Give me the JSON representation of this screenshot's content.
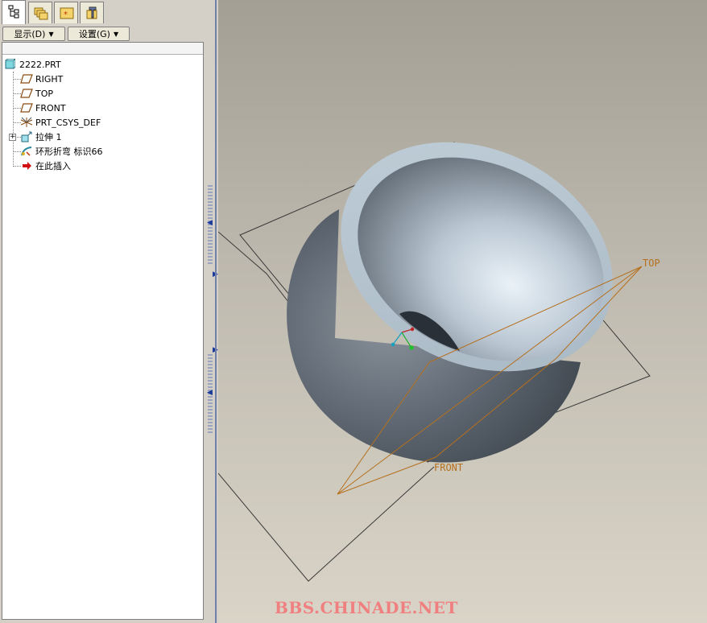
{
  "tabs": [
    {
      "name": "model-tree",
      "icon": "model-tree-icon",
      "active": true
    },
    {
      "name": "folder-browser",
      "icon": "folders-icon",
      "active": false
    },
    {
      "name": "favorites",
      "icon": "favorites-icon",
      "active": false
    },
    {
      "name": "connections",
      "icon": "tools-icon",
      "active": false
    }
  ],
  "toolbar": {
    "display_label": "显示(D)",
    "settings_label": "设置(G)"
  },
  "tree": {
    "root": "2222.PRT",
    "items": [
      {
        "label": "RIGHT",
        "icon": "datum-plane-icon"
      },
      {
        "label": "TOP",
        "icon": "datum-plane-icon"
      },
      {
        "label": "FRONT",
        "icon": "datum-plane-icon"
      },
      {
        "label": "PRT_CSYS_DEF",
        "icon": "coordinate-system-icon"
      },
      {
        "label": "拉伸 1",
        "icon": "extrude-icon"
      },
      {
        "label": "环形折弯 标识66",
        "icon": "toroidal-bend-icon"
      },
      {
        "label": "在此插入",
        "icon": "insert-here-arrow-icon"
      }
    ]
  },
  "viewport": {
    "plane_labels": {
      "top": "TOP",
      "front": "FRONT"
    },
    "watermark": "BBS.CHINADE.NET",
    "colors": {
      "bg_top": "#a39f94",
      "bg_bottom": "#d9d4c7",
      "part_dark": "#4a525c",
      "part_light": "#c8d4e0",
      "plane_top": "#b5701e",
      "plane_line": "#3a3a3a"
    }
  }
}
